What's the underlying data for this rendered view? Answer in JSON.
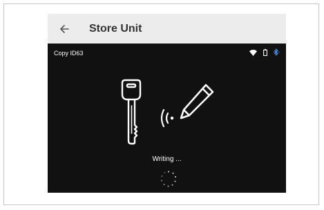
{
  "appbar": {
    "title": "Store Unit",
    "back_icon": "arrow-left-icon"
  },
  "statusbar": {
    "device_id": "Copy ID63",
    "icons": [
      "wifi-icon",
      "battery-icon",
      "bluetooth-icon"
    ]
  },
  "main": {
    "status_text": "Writing ...",
    "illustration_icons": [
      "key-icon",
      "nfc-signal-icon",
      "pencil-icon"
    ],
    "spinner_icon": "loading-spinner-icon"
  },
  "colors": {
    "appbar_bg": "#ececec",
    "screen_bg": "#111111",
    "accent_bluetooth": "#4a8fe8",
    "text_light": "#ffffff"
  }
}
